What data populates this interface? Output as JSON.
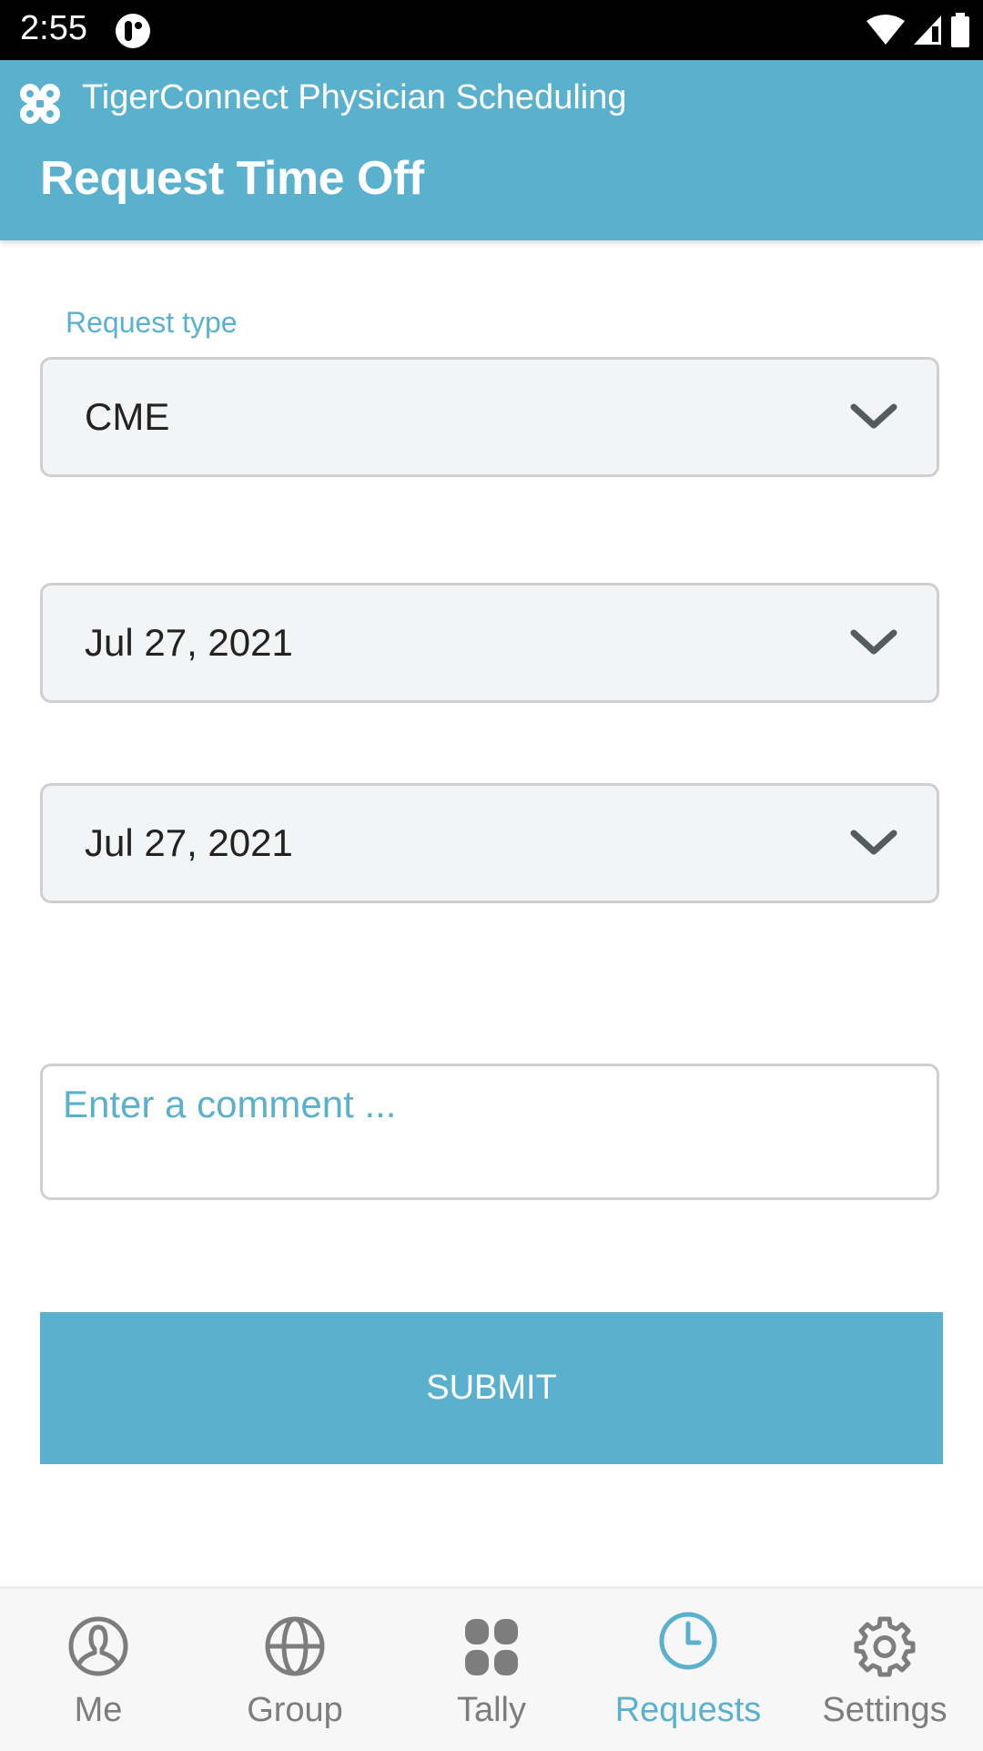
{
  "status_bar": {
    "time": "2:55"
  },
  "app_bar": {
    "app_name": "TigerConnect Physician Scheduling",
    "title": "Request Time Off"
  },
  "form": {
    "request_type_label": "Request type",
    "request_type_value": "CME",
    "start_date": "Jul 27, 2021",
    "end_date": "Jul 27, 2021",
    "comment_placeholder": "Enter a comment ...",
    "comment_value": "",
    "submit_label": "SUBMIT"
  },
  "bottom_nav": {
    "items": [
      {
        "label": "Me",
        "icon": "person-icon",
        "active": false
      },
      {
        "label": "Group",
        "icon": "globe-icon",
        "active": false
      },
      {
        "label": "Tally",
        "icon": "grid-icon",
        "active": false
      },
      {
        "label": "Requests",
        "icon": "clock-icon",
        "active": true
      },
      {
        "label": "Settings",
        "icon": "gear-icon",
        "active": false
      }
    ]
  },
  "colors": {
    "accent": "#5ab1cd",
    "inactive": "#7d7d7d"
  }
}
